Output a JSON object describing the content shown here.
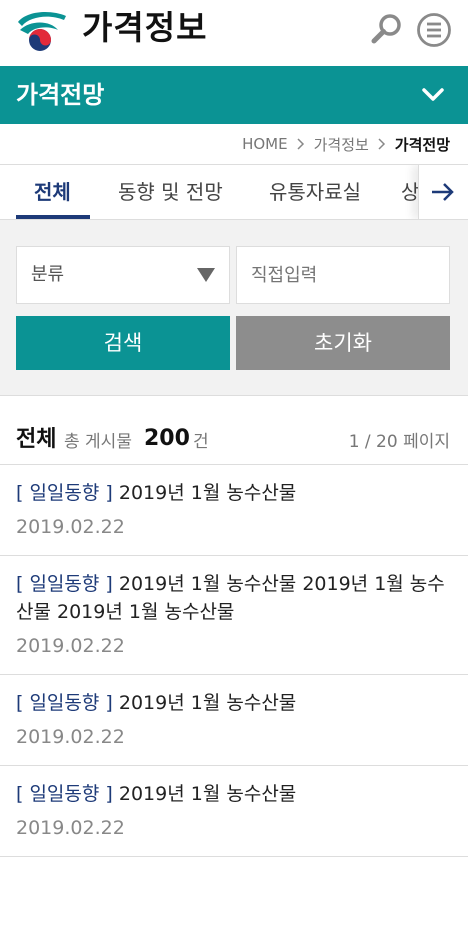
{
  "header": {
    "brand": "가격정보",
    "logo_icon": "government-taegeuk-logo",
    "search_icon": "search-icon",
    "menu_icon": "menu-icon"
  },
  "section": {
    "title": "가격전망",
    "toggle_icon": "chevron-down-icon",
    "color": "#0b9394"
  },
  "breadcrumb": {
    "items": [
      "HOME",
      "가격정보",
      "가격전망"
    ]
  },
  "tabs": {
    "items": [
      {
        "label": "전체",
        "active": true
      },
      {
        "label": "동향 및 전망",
        "active": false
      },
      {
        "label": "유통자료실",
        "active": false
      },
      {
        "label": "상",
        "active": false
      }
    ],
    "next_icon": "arrow-right-icon",
    "accent": "#1d3a78"
  },
  "search": {
    "category_label": "분류",
    "input_placeholder": "직접입력",
    "search_button": "검색",
    "reset_button": "초기화"
  },
  "list_header": {
    "title": "전체",
    "total_label": "총 게시물",
    "total_count": "200",
    "total_unit": "건",
    "pagination": "1 / 20 페이지"
  },
  "posts": [
    {
      "category": "[ 일일동향 ]",
      "title": "2019년 1월 농수산물",
      "date": "2019.02.22"
    },
    {
      "category": "[ 일일동향 ]",
      "title": "2019년 1월 농수산물 2019년 1월 농수산물 2019년 1월 농수산물",
      "date": "2019.02.22"
    },
    {
      "category": "[ 일일동향 ]",
      "title": "2019년 1월 농수산물",
      "date": "2019.02.22"
    },
    {
      "category": "[ 일일동향 ]",
      "title": "2019년 1월 농수산물",
      "date": "2019.02.22"
    }
  ]
}
